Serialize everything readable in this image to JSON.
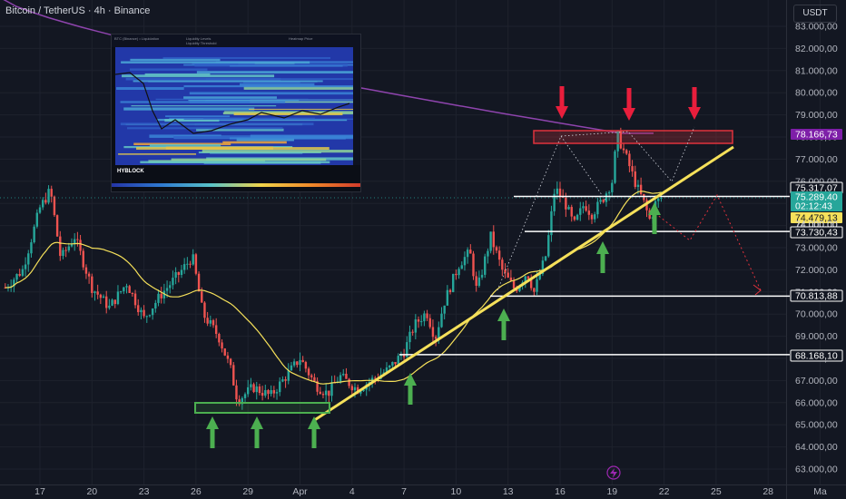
{
  "header": {
    "title": "Bitcoin / TetherUS · 4h · Binance",
    "currency": "USDT"
  },
  "inset": {
    "brand": "HYBLOCK",
    "header_left": "BTC (Binance) • Liquidation",
    "header_mid_1": "Liquidity Levels",
    "header_mid_2": "Liquidity Threshold",
    "header_right": "Heatmap Price"
  },
  "colors": {
    "background": "#131722",
    "candle_up": "#26a69a",
    "candle_down": "#ef5350",
    "ma": "#f5e05a",
    "trendline": "#f5e05a",
    "ma_long": "#8e44ad",
    "resistance_box": "#e0323c",
    "support_box": "#4caf50",
    "arrow_up": "#4caf50",
    "arrow_down": "#e91e3c",
    "level_line": "#ffffff",
    "green_label": "#26a69a"
  },
  "chart_data": {
    "type": "candlestick",
    "y_range": [
      62600,
      83600
    ],
    "y_ticks": [
      "83.000,00",
      "82.000,00",
      "81.000,00",
      "80.000,00",
      "79.000,00",
      "78.000,00",
      "77.000,00",
      "76.000,00",
      "75.000,00",
      "74.000,00",
      "73.000,00",
      "72.000,00",
      "71.000,00",
      "70.000,00",
      "69.000,00",
      "68.000,00",
      "67.000,00",
      "66.000,00",
      "65.000,00",
      "64.000,00",
      "63.000,00"
    ],
    "x_ticks": [
      "17",
      "20",
      "23",
      "26",
      "29",
      "Apr",
      "4",
      "7",
      "10",
      "13",
      "16",
      "19",
      "22",
      "25",
      "28",
      "Ma"
    ],
    "price_labels": [
      {
        "text": "78.166,73",
        "style": "purple"
      },
      {
        "text": "75.317,07",
        "style": "white"
      },
      {
        "text": "75.289,40",
        "style": "green"
      },
      {
        "text": "02:12:43",
        "style": "green"
      },
      {
        "text": "74.479,13",
        "style": "yellow"
      },
      {
        "text": "74.000,00",
        "style": "white"
      },
      {
        "text": "73.730,43",
        "style": "white"
      },
      {
        "text": "70.813,88",
        "style": "white"
      },
      {
        "text": "68.168,10",
        "style": "white"
      }
    ],
    "levels": [
      75317.07,
      73730.43,
      70813.88,
      68168.1
    ],
    "path_points": [
      [
        62.0,
        84300
      ],
      [
        62.5,
        84000
      ],
      [
        63.0,
        83500
      ],
      [
        63.5,
        83000
      ],
      [
        64.0,
        82700
      ],
      [
        64.5,
        82400
      ],
      [
        65.0,
        82100
      ],
      [
        65.5,
        81700
      ],
      [
        66.0,
        81400
      ],
      [
        66.5,
        80800
      ],
      [
        67.0,
        80400
      ],
      [
        67.5,
        80100
      ],
      [
        68.0,
        79800
      ],
      [
        68.5,
        79500
      ],
      [
        69.0,
        79200
      ],
      [
        69.5,
        79000
      ],
      [
        70.0,
        78800
      ],
      [
        70.5,
        78500
      ],
      [
        71.0,
        78400
      ],
      [
        71.5,
        78300
      ],
      [
        72.0,
        78200
      ],
      [
        72.5,
        78170
      ]
    ]
  }
}
